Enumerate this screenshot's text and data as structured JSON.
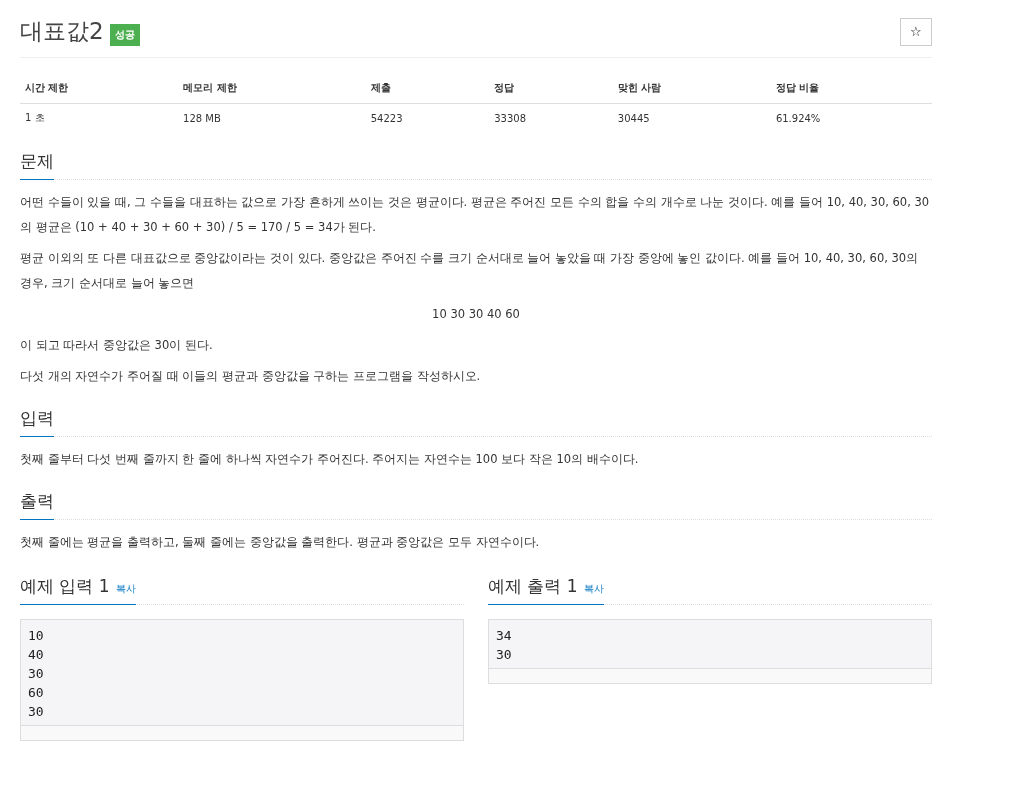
{
  "title": "대표값2",
  "result_badge": "성공",
  "star_button": "☆",
  "info_table": {
    "columns": [
      "시간 제한",
      "메모리 제한",
      "제출",
      "정답",
      "맞힌 사람",
      "정답 비율"
    ],
    "rows": [
      [
        "1 초",
        "128 MB",
        "54223",
        "33308",
        "30445",
        "61.924%"
      ]
    ]
  },
  "sections": [
    {
      "heading": "문제",
      "blocks": [
        {
          "kind": "paragraph",
          "text": "어떤 수들이 있을 때, 그 수들을 대표하는 값으로 가장 흔하게 쓰이는 것은 평균이다. 평균은 주어진 모든 수의 합을 수의 개수로 나눈 것이다. 예를 들어 10, 40, 30, 60, 30의 평균은 (10 + 40 + 30 + 60 + 30) / 5 = 170 / 5 = 34가 된다."
        },
        {
          "kind": "paragraph",
          "text": "평균 이외의 또 다른 대표값으로 중앙값이라는 것이 있다. 중앙값은 주어진 수를 크기 순서대로 늘어 놓았을 때 가장 중앙에 놓인 값이다. 예를 들어 10, 40, 30, 60, 30의 경우, 크기 순서대로 늘어 놓으면"
        },
        {
          "kind": "centered",
          "text": "10 30 30 40 60"
        },
        {
          "kind": "paragraph",
          "text": "이 되고 따라서 중앙값은 30이 된다."
        },
        {
          "kind": "paragraph",
          "text": "다섯 개의 자연수가 주어질 때 이들의 평균과 중앙값을 구하는 프로그램을 작성하시오."
        }
      ]
    },
    {
      "heading": "입력",
      "blocks": [
        {
          "kind": "paragraph",
          "text": "첫째 줄부터 다섯 번째 줄까지 한 줄에 하나씩 자연수가 주어진다. 주어지는 자연수는 100 보다 작은 10의 배수이다."
        }
      ]
    },
    {
      "heading": "출력",
      "blocks": [
        {
          "kind": "paragraph",
          "text": "첫째 줄에는 평균을 출력하고, 둘째 줄에는 중앙값을 출력한다. 평균과 중앙값은 모두 자연수이다."
        }
      ]
    }
  ],
  "samples": [
    {
      "heading": "예제 입력 1",
      "copy_link": "복사",
      "lines": [
        "10",
        "40",
        "30",
        "60",
        "30"
      ]
    },
    {
      "heading": "예제 출력 1",
      "copy_link": "복사",
      "lines": [
        "34",
        "30"
      ]
    }
  ]
}
